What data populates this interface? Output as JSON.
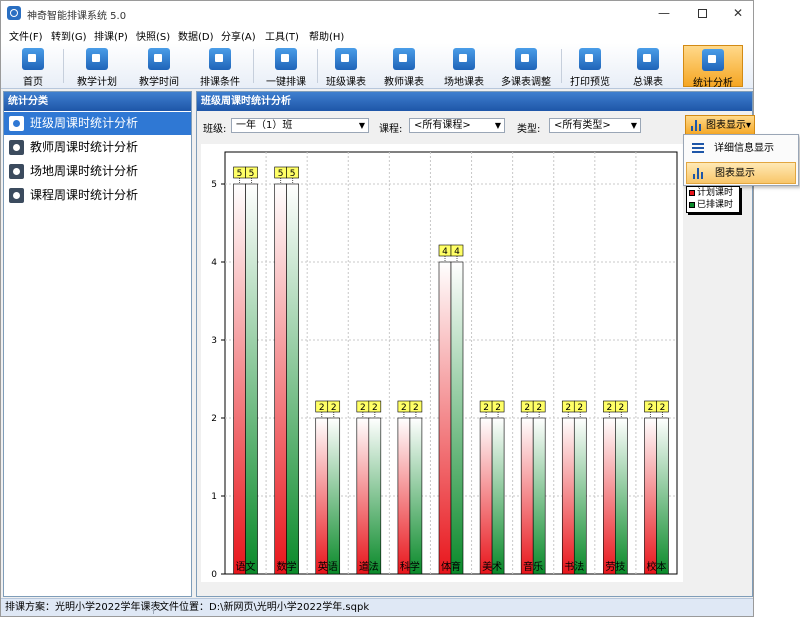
{
  "window": {
    "title": "神奇智能排课系统 5.0"
  },
  "menu": [
    "文件(F)",
    "转到(G)",
    "排课(P)",
    "快照(S)",
    "数据(D)",
    "分享(A)",
    "工具(T)",
    "帮助(H)"
  ],
  "toolbar": [
    "首页",
    "教学计划",
    "教学时间",
    "排课条件",
    "一键排课",
    "班级课表",
    "教师课表",
    "场地课表",
    "多课表调整",
    "打印预览",
    "总课表",
    "统计分析"
  ],
  "left_panel": {
    "title": "统计分类",
    "items": [
      "班级周课时统计分析",
      "教师周课时统计分析",
      "场地周课时统计分析",
      "课程周课时统计分析"
    ]
  },
  "right_panel": {
    "title": "班级周课时统计分析",
    "class_label": "班级:",
    "class_value": "一年（1）班",
    "course_label": "课程:",
    "course_value": "<所有课程>",
    "type_label": "类型:",
    "type_value": "<所有类型>",
    "view_button": "图表显示"
  },
  "view_menu": [
    "详细信息显示",
    "图表显示"
  ],
  "status": {
    "plan": "排课方案：光明小学2022学年课表",
    "file": "文件位置：D:\\新网页\\光明小学2022学年.sqpk"
  },
  "colors": {
    "planned": "#e8151b",
    "scheduled": "#0a8a2a",
    "header": "#1e56a8",
    "accent": "#f5a623"
  },
  "chart_data": {
    "type": "bar",
    "categories": [
      "语文",
      "数学",
      "英语",
      "道法",
      "科学",
      "体育",
      "美术",
      "音乐",
      "书法",
      "劳技",
      "校本"
    ],
    "series": [
      {
        "name": "计划课时",
        "values": [
          5,
          5,
          2,
          2,
          2,
          4,
          2,
          2,
          2,
          2,
          2
        ]
      },
      {
        "name": "已排课时",
        "values": [
          5,
          5,
          2,
          2,
          2,
          4,
          2,
          2,
          2,
          2,
          2
        ]
      }
    ],
    "yticks": [
      "0",
      "1",
      "2",
      "3",
      "4",
      "5"
    ],
    "ylim": [
      0,
      5
    ],
    "grid": true,
    "legend": "right"
  }
}
